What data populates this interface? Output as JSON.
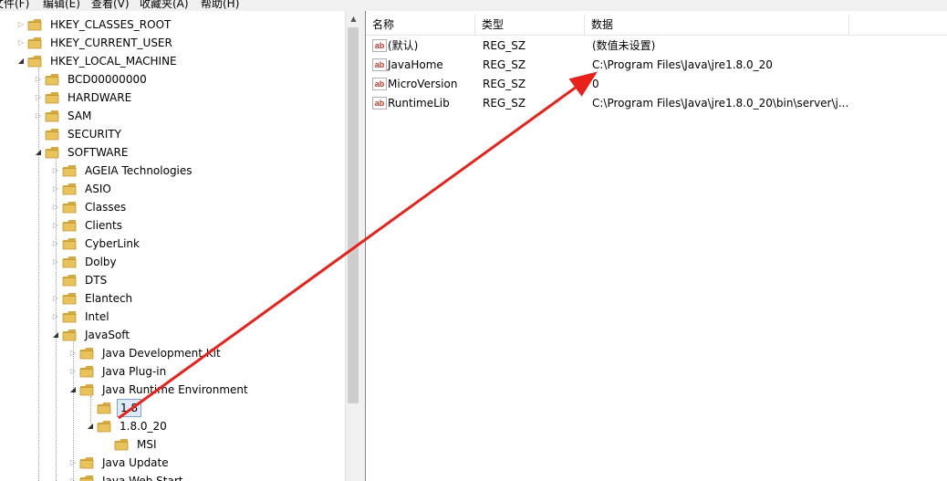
{
  "menu": {
    "items": [
      {
        "label": "文件(F)"
      },
      {
        "label": "编辑(E)"
      },
      {
        "label": "查看(V)"
      },
      {
        "label": "收藏夹(A)"
      },
      {
        "label": "帮助(H)"
      }
    ]
  },
  "tree": {
    "items": [
      {
        "label": "HKEY_CLASSES_ROOT",
        "state": "collapsed"
      },
      {
        "label": "HKEY_CURRENT_USER",
        "state": "collapsed"
      },
      {
        "label": "HKEY_LOCAL_MACHINE",
        "state": "expanded"
      },
      {
        "label": "BCD00000000",
        "state": "collapsed"
      },
      {
        "label": "HARDWARE",
        "state": "collapsed"
      },
      {
        "label": "SAM",
        "state": "collapsed"
      },
      {
        "label": "SECURITY",
        "state": "none"
      },
      {
        "label": "SOFTWARE",
        "state": "expanded"
      },
      {
        "label": "AGEIA Technologies",
        "state": "collapsed"
      },
      {
        "label": "ASIO",
        "state": "collapsed"
      },
      {
        "label": "Classes",
        "state": "collapsed"
      },
      {
        "label": "Clients",
        "state": "collapsed"
      },
      {
        "label": "CyberLink",
        "state": "collapsed"
      },
      {
        "label": "Dolby",
        "state": "collapsed"
      },
      {
        "label": "DTS",
        "state": "none"
      },
      {
        "label": "Elantech",
        "state": "collapsed"
      },
      {
        "label": "Intel",
        "state": "collapsed"
      },
      {
        "label": "JavaSoft",
        "state": "expanded"
      },
      {
        "label": "Java Development Kit",
        "state": "collapsed"
      },
      {
        "label": "Java Plug-in",
        "state": "collapsed"
      },
      {
        "label": "Java Runtime Environment",
        "state": "expanded"
      },
      {
        "label": "1.8",
        "state": "none",
        "selected": true
      },
      {
        "label": "1.8.0_20",
        "state": "expanded"
      },
      {
        "label": "MSI",
        "state": "none"
      },
      {
        "label": "Java Update",
        "state": "collapsed"
      },
      {
        "label": "Java Web Start",
        "state": "collapsed"
      }
    ]
  },
  "list": {
    "columns": {
      "name": "名称",
      "type": "类型",
      "data": "数据"
    },
    "rows": [
      {
        "icon": "string-value-icon",
        "icon_text": "ab",
        "name": "(默认)",
        "type": "REG_SZ",
        "data": "(数值未设置)"
      },
      {
        "icon": "string-value-icon",
        "icon_text": "ab",
        "name": "JavaHome",
        "type": "REG_SZ",
        "data": "C:\\Program Files\\Java\\jre1.8.0_20"
      },
      {
        "icon": "string-value-icon",
        "icon_text": "ab",
        "name": "MicroVersion",
        "type": "REG_SZ",
        "data": "0"
      },
      {
        "icon": "string-value-icon",
        "icon_text": "ab",
        "name": "RuntimeLib",
        "type": "REG_SZ",
        "data": "C:\\Program Files\\Java\\jre1.8.0_20\\bin\\server\\j..."
      }
    ]
  },
  "annotation": {
    "arrow_color": "#e8221b"
  },
  "colors": {
    "folder": "#e8c35a",
    "selection": "#dde9f6",
    "value_icon_text": "#c0392b"
  }
}
